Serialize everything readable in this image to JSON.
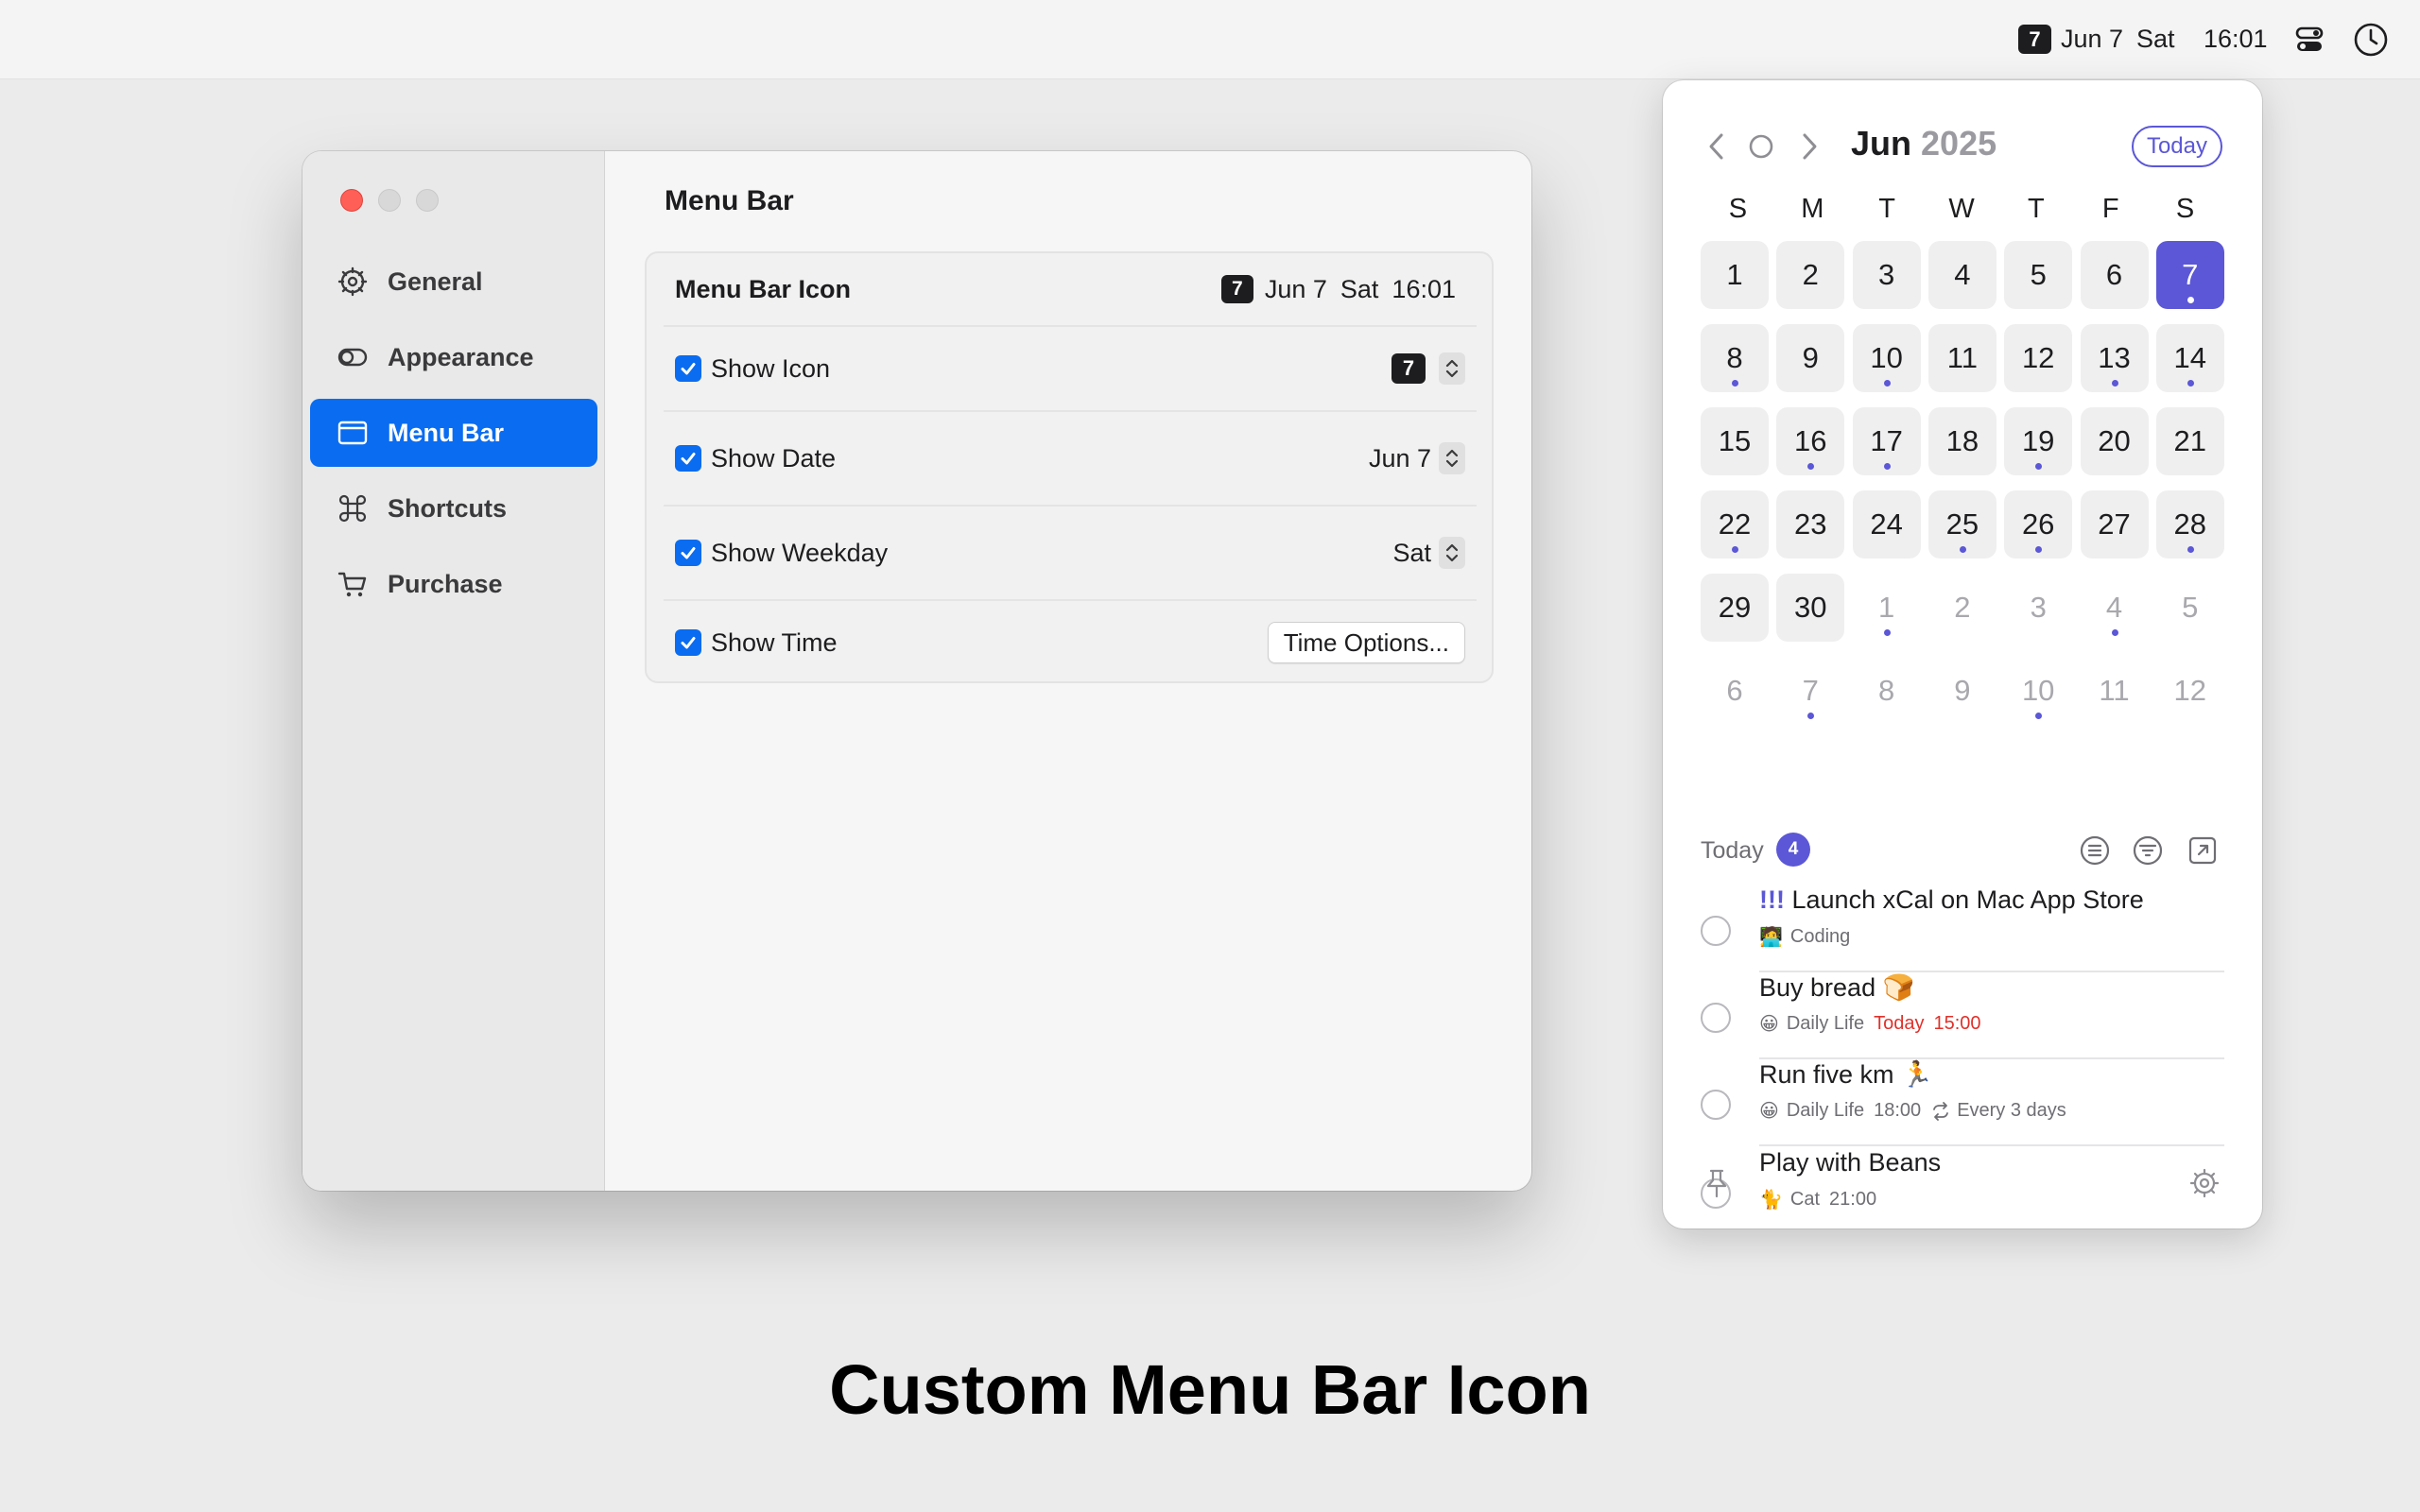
{
  "menubar": {
    "day_number": "7",
    "date": "Jun 7",
    "weekday": "Sat",
    "time": "16:01",
    "icons": [
      "control-center-icon",
      "clock-icon"
    ]
  },
  "settings": {
    "sidebar": {
      "items": [
        {
          "label": "General",
          "icon": "gear-icon"
        },
        {
          "label": "Appearance",
          "icon": "toggle-icon"
        },
        {
          "label": "Menu Bar",
          "icon": "window-icon",
          "active": true
        },
        {
          "label": "Shortcuts",
          "icon": "command-icon"
        },
        {
          "label": "Purchase",
          "icon": "cart-icon"
        }
      ]
    },
    "title": "Menu Bar",
    "card": {
      "header_title": "Menu Bar Icon",
      "preview": {
        "day": "7",
        "date": "Jun 7",
        "weekday": "Sat",
        "time": "16:01"
      },
      "rows": [
        {
          "label": "Show Icon",
          "checked": true,
          "value": "7"
        },
        {
          "label": "Show Date",
          "checked": true,
          "value": "Jun 7"
        },
        {
          "label": "Show Weekday",
          "checked": true,
          "value": "Sat"
        },
        {
          "label": "Show Time",
          "checked": true,
          "button": "Time Options..."
        }
      ]
    }
  },
  "calendar": {
    "month": "Jun",
    "year": "2025",
    "today_label": "Today",
    "weekdays": [
      "S",
      "M",
      "T",
      "W",
      "T",
      "F",
      "S"
    ],
    "weeks": [
      [
        {
          "d": "1",
          "in": true
        },
        {
          "d": "2",
          "in": true
        },
        {
          "d": "3",
          "in": true
        },
        {
          "d": "4",
          "in": true
        },
        {
          "d": "5",
          "in": true
        },
        {
          "d": "6",
          "in": true
        },
        {
          "d": "7",
          "in": true,
          "selected": true,
          "dot": true
        }
      ],
      [
        {
          "d": "8",
          "in": true,
          "dot": true
        },
        {
          "d": "9",
          "in": true
        },
        {
          "d": "10",
          "in": true,
          "dot": true
        },
        {
          "d": "11",
          "in": true
        },
        {
          "d": "12",
          "in": true
        },
        {
          "d": "13",
          "in": true,
          "dot": true
        },
        {
          "d": "14",
          "in": true,
          "dot": true
        }
      ],
      [
        {
          "d": "15",
          "in": true
        },
        {
          "d": "16",
          "in": true,
          "dot": true
        },
        {
          "d": "17",
          "in": true,
          "dot": true
        },
        {
          "d": "18",
          "in": true
        },
        {
          "d": "19",
          "in": true,
          "dot": true
        },
        {
          "d": "20",
          "in": true
        },
        {
          "d": "21",
          "in": true
        }
      ],
      [
        {
          "d": "22",
          "in": true,
          "dot": true
        },
        {
          "d": "23",
          "in": true
        },
        {
          "d": "24",
          "in": true
        },
        {
          "d": "25",
          "in": true,
          "dot": true
        },
        {
          "d": "26",
          "in": true,
          "dot": true
        },
        {
          "d": "27",
          "in": true
        },
        {
          "d": "28",
          "in": true,
          "dot": true
        }
      ],
      [
        {
          "d": "29",
          "in": true
        },
        {
          "d": "30",
          "in": true
        },
        {
          "d": "1",
          "in": false,
          "dot": true
        },
        {
          "d": "2",
          "in": false
        },
        {
          "d": "3",
          "in": false
        },
        {
          "d": "4",
          "in": false,
          "dot": true
        },
        {
          "d": "5",
          "in": false
        }
      ],
      [
        {
          "d": "6",
          "in": false
        },
        {
          "d": "7",
          "in": false,
          "dot": true
        },
        {
          "d": "8",
          "in": false
        },
        {
          "d": "9",
          "in": false
        },
        {
          "d": "10",
          "in": false,
          "dot": true
        },
        {
          "d": "11",
          "in": false
        },
        {
          "d": "12",
          "in": false
        }
      ]
    ],
    "tasks_label": "Today",
    "tasks_count": "4",
    "tasks": [
      {
        "priority": "!!!",
        "title": "Launch xCal on Mac App Store",
        "emoji": "🧑‍💻",
        "list": "Coding"
      },
      {
        "title": "Buy bread 🍞",
        "emoji": "😀",
        "list": "Daily Life",
        "due_day": "Today",
        "due_time": "15:00"
      },
      {
        "title": "Run five km 🏃",
        "emoji": "😀",
        "list": "Daily Life",
        "time": "18:00",
        "repeat": "Every 3 days"
      },
      {
        "title": "Play with Beans",
        "emoji": "🐈",
        "list": "Cat",
        "time": "21:00"
      }
    ],
    "colors": {
      "accent": "#5b57d6",
      "due": "#e0312b"
    }
  },
  "caption": "Custom Menu Bar Icon"
}
